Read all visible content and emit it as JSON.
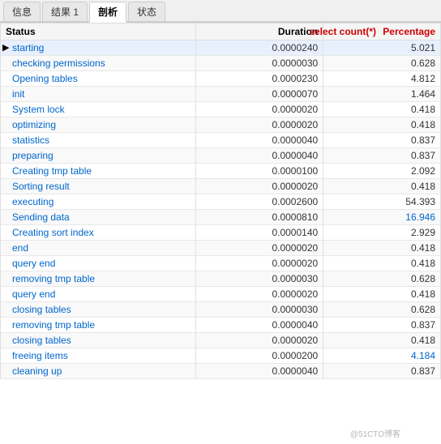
{
  "tabs": [
    {
      "label": "信息",
      "active": false
    },
    {
      "label": "结果 1",
      "active": false
    },
    {
      "label": "剖析",
      "active": true
    },
    {
      "label": "状态",
      "active": false
    }
  ],
  "select_count_label": "select count(*)",
  "columns": [
    {
      "label": "Status"
    },
    {
      "label": "Duration"
    },
    {
      "label": "Percentage"
    }
  ],
  "rows": [
    {
      "status": "starting",
      "duration": "0.0000240",
      "percentage": "5.021",
      "selected": true,
      "pct_color": "normal"
    },
    {
      "status": "checking permissions",
      "duration": "0.0000030",
      "percentage": "0.628",
      "selected": false,
      "pct_color": "normal"
    },
    {
      "status": "Opening tables",
      "duration": "0.0000230",
      "percentage": "4.812",
      "selected": false,
      "pct_color": "normal"
    },
    {
      "status": "init",
      "duration": "0.0000070",
      "percentage": "1.464",
      "selected": false,
      "pct_color": "normal"
    },
    {
      "status": "System lock",
      "duration": "0.0000020",
      "percentage": "0.418",
      "selected": false,
      "pct_color": "normal"
    },
    {
      "status": "optimizing",
      "duration": "0.0000020",
      "percentage": "0.418",
      "selected": false,
      "pct_color": "normal"
    },
    {
      "status": "statistics",
      "duration": "0.0000040",
      "percentage": "0.837",
      "selected": false,
      "pct_color": "normal"
    },
    {
      "status": "preparing",
      "duration": "0.0000040",
      "percentage": "0.837",
      "selected": false,
      "pct_color": "normal"
    },
    {
      "status": "Creating tmp table",
      "duration": "0.0000100",
      "percentage": "2.092",
      "selected": false,
      "pct_color": "normal"
    },
    {
      "status": "Sorting result",
      "duration": "0.0000020",
      "percentage": "0.418",
      "selected": false,
      "pct_color": "normal"
    },
    {
      "status": "executing",
      "duration": "0.0002600",
      "percentage": "54.393",
      "selected": false,
      "pct_color": "normal"
    },
    {
      "status": "Sending data",
      "duration": "0.0000810",
      "percentage": "16.946",
      "selected": false,
      "pct_color": "blue"
    },
    {
      "status": "Creating sort index",
      "duration": "0.0000140",
      "percentage": "2.929",
      "selected": false,
      "pct_color": "normal"
    },
    {
      "status": "end",
      "duration": "0.0000020",
      "percentage": "0.418",
      "selected": false,
      "pct_color": "normal"
    },
    {
      "status": "query end",
      "duration": "0.0000020",
      "percentage": "0.418",
      "selected": false,
      "pct_color": "normal"
    },
    {
      "status": "removing tmp table",
      "duration": "0.0000030",
      "percentage": "0.628",
      "selected": false,
      "pct_color": "normal"
    },
    {
      "status": "query end",
      "duration": "0.0000020",
      "percentage": "0.418",
      "selected": false,
      "pct_color": "normal"
    },
    {
      "status": "closing tables",
      "duration": "0.0000030",
      "percentage": "0.628",
      "selected": false,
      "pct_color": "normal"
    },
    {
      "status": "removing tmp table",
      "duration": "0.0000040",
      "percentage": "0.837",
      "selected": false,
      "pct_color": "normal"
    },
    {
      "status": "closing tables",
      "duration": "0.0000020",
      "percentage": "0.418",
      "selected": false,
      "pct_color": "normal"
    },
    {
      "status": "freeing items",
      "duration": "0.0000200",
      "percentage": "4.184",
      "selected": false,
      "pct_color": "blue"
    },
    {
      "status": "cleaning up",
      "duration": "0.0000040",
      "percentage": "0.837",
      "selected": false,
      "pct_color": "normal"
    }
  ],
  "watermark": "@51CTO博客"
}
